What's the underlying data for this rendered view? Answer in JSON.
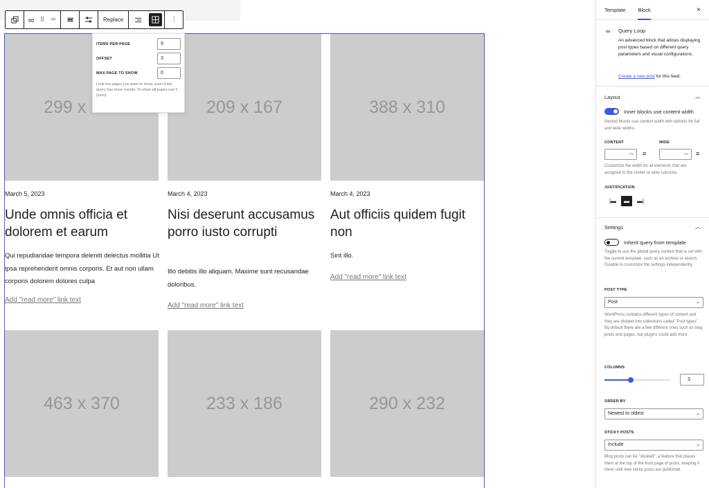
{
  "toolbar": {
    "replace_label": "Replace"
  },
  "popover": {
    "items_per_page_label": "ITEMS PER PAGE",
    "items_per_page_value": "9",
    "offset_label": "OFFSET",
    "offset_value": "3",
    "max_page_label": "MAX PAGE TO SHOW",
    "max_page_value": "0",
    "help": "Limit the pages you want to show, even if the query has more results. To show all pages use 0 (zero)."
  },
  "posts": [
    {
      "thumb": "299 x 239",
      "date": "March 5, 2023",
      "title": "Unde omnis officia et dolorem et earum",
      "excerpt": "Qui repudiandae tempora deleniti delectus mollitia Ut ipsa reprehenderit omnis corporis. Et aut non ullam corporis dolorem dolores culpa",
      "more": "Add \"read more\" link text"
    },
    {
      "thumb": "209 x 167",
      "date": "March 4, 2023",
      "title": "Nisi deserunt accusamus porro iusto corrupti",
      "excerpt": "Illo debitis illo aliquam. Maxime sunt recusandae doloribus.",
      "more": "Add \"read more\" link text"
    },
    {
      "thumb": "388 x 310",
      "date": "March 4, 2023",
      "title": "Aut officiis quidem fugit non",
      "excerpt": "Sint illo.",
      "more": "Add \"read more\" link text"
    },
    {
      "thumb": "463 x 370"
    },
    {
      "thumb": "233 x 186"
    },
    {
      "thumb": "290 x 232"
    }
  ],
  "sidebar": {
    "tab_template": "Template",
    "tab_block": "Block",
    "close": "×",
    "block_title": "Query Loop",
    "block_desc": "An advanced block that allows displaying post types based on different query parameters and visual configurations.",
    "create_link": "Create a new post",
    "create_suffix": " for this feed.",
    "layout": {
      "title": "Layout",
      "toggle_label": "Inner blocks use content width",
      "toggle_help": "Nested blocks use content width with options for full and wide widths.",
      "content_label": "CONTENT",
      "wide_label": "WIDE",
      "unit": "PX",
      "width_help": "Customize the width for all elements that are assigned to the center or wide columns.",
      "justification_label": "JUSTIFICATION"
    },
    "settings": {
      "title": "Settings",
      "inherit_label": "Inherit query from template",
      "inherit_help": "Toggle to use the global query context that is set with the current template, such as an archive or search. Disable to customize the settings independently.",
      "post_type_label": "POST TYPE",
      "post_type_value": "Post",
      "post_type_help": "WordPress contains different types of content and they are divided into collections called \"Post types\". By default there are a few different ones such as blog posts and pages, but plugins could add more.",
      "columns_label": "COLUMNS",
      "columns_value": "3",
      "columns_fraction": 0.4,
      "order_label": "ORDER BY",
      "order_value": "Newest to oldest",
      "sticky_label": "STICKY POSTS",
      "sticky_value": "Include",
      "sticky_help": "Blog posts can be \"stickied\", a feature that places them at the top of the front page of posts, keeping it there until new sticky posts are published."
    }
  },
  "colors": {
    "accent": "#3858e9",
    "placeholder": "#cccccc"
  }
}
